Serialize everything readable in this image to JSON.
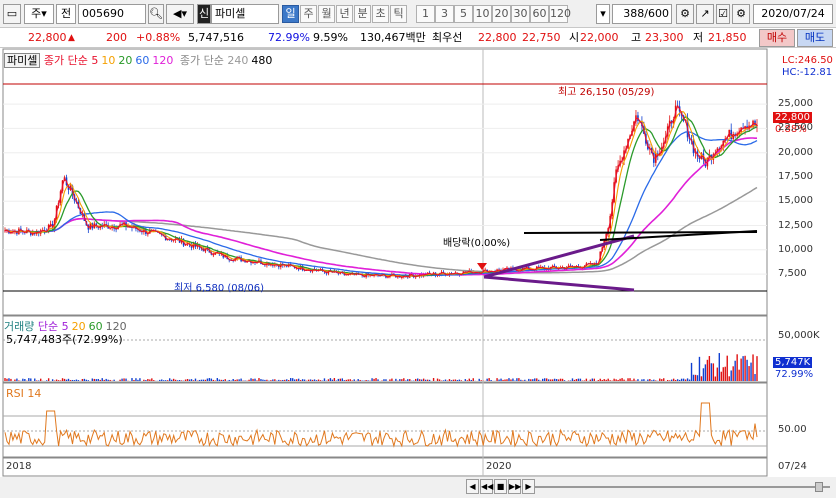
{
  "toolbar": {
    "menu_icon": "window-menu-icon",
    "type_label": "주",
    "type2_label": "전",
    "code": "005690",
    "name_badge": "신",
    "name": "파미셀",
    "periods": [
      "일",
      "주",
      "월",
      "년",
      "분",
      "초",
      "틱"
    ],
    "numbers": [
      "1",
      "3",
      "5",
      "10",
      "20",
      "30",
      "60",
      "120"
    ],
    "count": "388",
    "count_total": "/600",
    "date": "2020/07/24"
  },
  "quote": {
    "price": "22,800",
    "change": "200",
    "change_pct": "+0.88%",
    "volume": "5,747,516",
    "vol_ratio": "72.99%",
    "turnover": "9.59%",
    "amount": "130,467백만",
    "best_label": "최우선",
    "best_ask": "22,800",
    "best_bid": "22,750",
    "open_label": "시",
    "open": "22,000",
    "high_label": "고",
    "high": "23,300",
    "low_label": "저",
    "low": "21,850",
    "buy_label": "매수",
    "sell_label": "매도",
    "up_color": "#e01010",
    "down_color": "#1010e0"
  },
  "price_panel": {
    "tab": "파미셀",
    "legend_main": "종가 단순",
    "ma": [
      "5",
      "10",
      "20",
      "60",
      "120"
    ],
    "ma_colors": [
      "#e8102c",
      "#f5a000",
      "#2a9a2a",
      "#2a6ae8",
      "#e020d8"
    ],
    "legend_long": "종가 단순",
    "long_ma": [
      "240",
      "480"
    ],
    "long_colors": [
      "#999999",
      "#000000"
    ],
    "lc": "LC:246.50",
    "hc": "HC:-12.81",
    "high_annot": "최고 26,150 (05/29)",
    "low_annot": "최저 6,580 (08/06)",
    "dividend": "배당락(0.00%)",
    "price_chip": "22,800",
    "pct_chip": "0.88%",
    "yticks": [
      "25,000",
      "22,500",
      "20,000",
      "17,500",
      "15,000",
      "12,500",
      "10,000",
      "7,500"
    ]
  },
  "volume_panel": {
    "legend": "거래량",
    "legend_ma": "단순",
    "ma": [
      "5",
      "20",
      "60",
      "120"
    ],
    "ma_colors": [
      "#a020d8",
      "#f5a000",
      "#2a9a2a",
      "#666666"
    ],
    "value": "5,747,483주(72.99%)",
    "ytick": "50,000K",
    "chip": "5,747K",
    "chip_pct": "72.99%"
  },
  "rsi_panel": {
    "legend": "RSI 14",
    "ytick": "50.00",
    "color": "#e0781e"
  },
  "time_axis": {
    "labels": [
      "2018",
      "2020"
    ],
    "right": "07/24"
  },
  "controls": [
    "◀",
    "◀◀",
    "■",
    "▶▶",
    "▶"
  ]
}
